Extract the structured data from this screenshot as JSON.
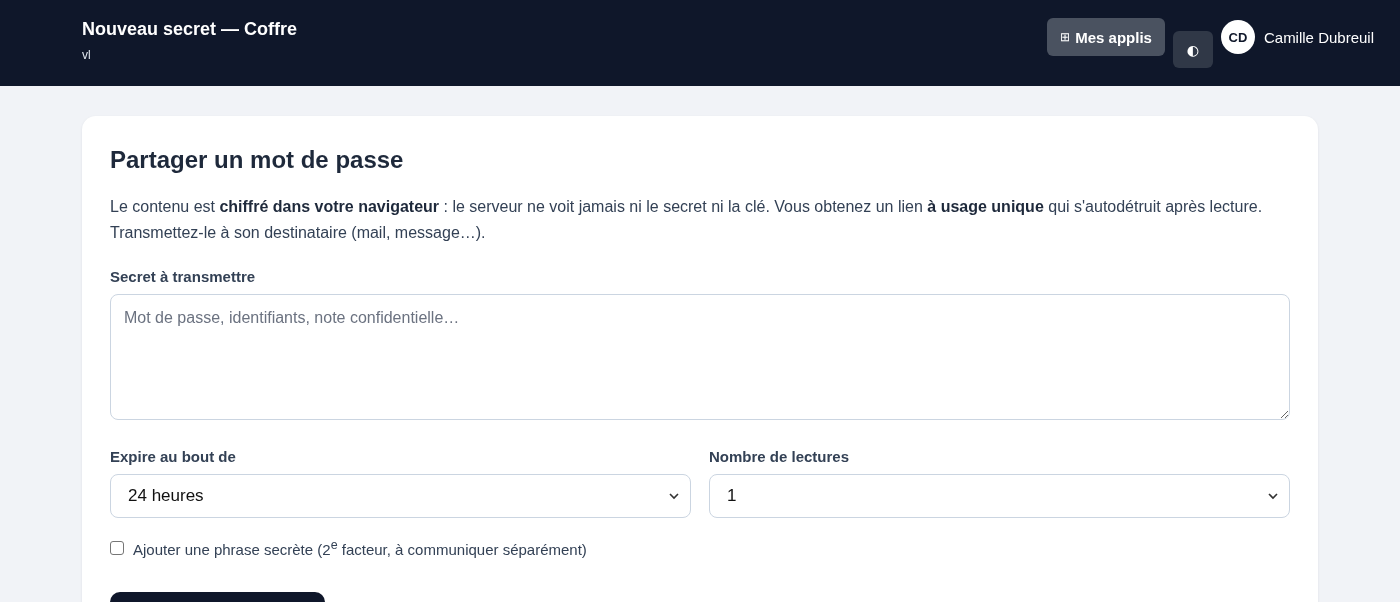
{
  "header": {
    "title": "Nouveau secret — Coffre",
    "subtitle": "vl",
    "apps_button": {
      "icon": "⊞",
      "label": "Mes applis"
    },
    "theme_button": {
      "icon": "◐"
    },
    "user": {
      "initials": "CD",
      "name": "Camille Dubreuil"
    }
  },
  "card": {
    "title": "Partager un mot de passe",
    "intro": "Le contenu est **chiffré dans votre navigateur** : le serveur ne voit jamais ni le secret ni la clé. Vous obtenez un lien **à usage unique** qui s'autodétruit après lecture. Transmettez-le à son destinataire (mail, message…).",
    "secret": {
      "label": "Secret à transmettre",
      "placeholder": "Mot de passe, identifiants, note confidentielle…"
    },
    "selects": [
      {
        "label": "Expire au bout de",
        "value": "24 heures"
      },
      {
        "label": "Nombre de lectures",
        "value": "1"
      }
    ],
    "passphrase": {
      "label": "Ajouter une phrase secrète (2$^{e}$ facteur, à communiquer séparément)",
      "checked": false
    }
  }
}
